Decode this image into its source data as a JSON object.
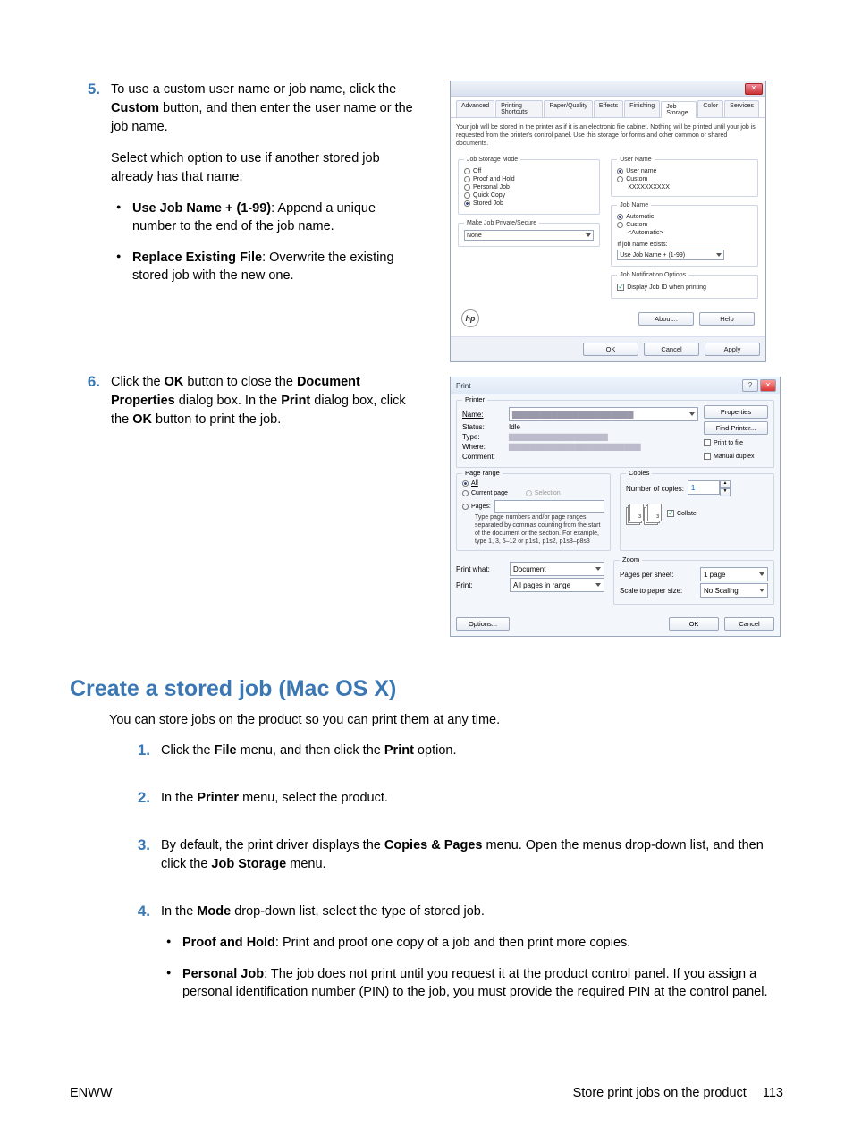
{
  "step5": {
    "num": "5.",
    "para1a": "To use a custom user name or job name, click the ",
    "para1b": "Custom",
    "para1c": " button, and then enter the user name or the job name.",
    "para2": "Select which option to use if another stored job already has that name:",
    "bullet1a": "Use Job Name + (1-99)",
    "bullet1b": ": Append a unique number to the end of the job name.",
    "bullet2a": "Replace Existing File",
    "bullet2b": ": Overwrite the existing stored job with the new one."
  },
  "step6": {
    "num": "6.",
    "a": "Click the ",
    "b": "OK",
    "c": " button to close the ",
    "d": "Document Properties",
    "e": " dialog box. In the ",
    "f": "Print",
    "g": " dialog box, click the ",
    "h": "OK",
    "i": " button to print the job."
  },
  "jobdlg": {
    "close": "✕",
    "tabs": [
      "Advanced",
      "Printing Shortcuts",
      "Paper/Quality",
      "Effects",
      "Finishing",
      "Job Storage",
      "Color",
      "Services"
    ],
    "activeTab": 5,
    "desc": "Your job will be stored in the printer as if it is an electronic file cabinet. Nothing will be printed until your job is requested from the printer's control panel. Use this storage for forms and other common or shared documents.",
    "mode_legend": "Job Storage Mode",
    "modes": [
      "Off",
      "Proof and Hold",
      "Personal Job",
      "Quick Copy",
      "Stored Job"
    ],
    "mode_sel": 4,
    "private_legend": "Make Job Private/Secure",
    "private_value": "None",
    "user_legend": "User Name",
    "user_opts": [
      "User name",
      "Custom"
    ],
    "user_sel": 0,
    "user_value": "XXXXXXXXXX",
    "job_legend": "Job Name",
    "job_opts": [
      "Automatic",
      "Custom"
    ],
    "job_sel": 0,
    "job_value": "<Automatic>",
    "exists_label": "If job name exists:",
    "exists_value": "Use Job Name + (1-99)",
    "notify_legend": "Job Notification Options",
    "notify_check": "Display Job ID when printing",
    "about": "About...",
    "help": "Help",
    "ok": "OK",
    "cancel": "Cancel",
    "apply": "Apply"
  },
  "printdlg": {
    "title": "Print",
    "printer_legend": "Printer",
    "name_lbl": "Name:",
    "status_lbl": "Status:",
    "status_val": "Idle",
    "type_lbl": "Type:",
    "where_lbl": "Where:",
    "comment_lbl": "Comment:",
    "properties": "Properties",
    "find": "Find Printer...",
    "printfile": "Print to file",
    "manual": "Manual duplex",
    "range_legend": "Page range",
    "range_all": "All",
    "range_cur": "Current page",
    "range_sel": "Selection",
    "range_pages": "Pages:",
    "range_note": "Type page numbers and/or page ranges separated by commas counting from the start of the document or the section. For example, type 1, 3, 5–12 or p1s1, p1s2, p1s3–p8s3",
    "copies_legend": "Copies",
    "num_copies": "Number of copies:",
    "copies_val": "1",
    "collate": "Collate",
    "printwhat_lbl": "Print what:",
    "printwhat_val": "Document",
    "print_lbl": "Print:",
    "print_val": "All pages in range",
    "zoom_legend": "Zoom",
    "pps_lbl": "Pages per sheet:",
    "pps_val": "1 page",
    "scale_lbl": "Scale to paper size:",
    "scale_val": "No Scaling",
    "options": "Options...",
    "ok": "OK",
    "cancel": "Cancel"
  },
  "section_h": "Create a stored job (Mac OS X)",
  "sec_intro": "You can store jobs on the product so you can print them at any time.",
  "mac1": {
    "n": "1.",
    "a": "Click the ",
    "b": "File",
    "c": " menu, and then click the ",
    "d": "Print",
    "e": " option."
  },
  "mac2": {
    "n": "2.",
    "a": "In the ",
    "b": "Printer",
    "c": " menu, select the product."
  },
  "mac3": {
    "n": "3.",
    "a": "By default, the print driver displays the ",
    "b": "Copies & Pages",
    "c": " menu. Open the menus drop-down list, and then click the ",
    "d": "Job Storage",
    "e": " menu."
  },
  "mac4": {
    "n": "4.",
    "a": "In the ",
    "b": "Mode",
    "c": " drop-down list, select the type of stored job."
  },
  "mac4b1": {
    "a": "Proof and Hold",
    "b": ": Print and proof one copy of a job and then print more copies."
  },
  "mac4b2": {
    "a": "Personal Job",
    "b": ": The job does not print until you request it at the product control panel. If you assign a personal identification number (PIN) to the job, you must provide the required PIN at the control panel."
  },
  "footer": {
    "left": "ENWW",
    "right": "Store print jobs on the product",
    "page": "113"
  }
}
